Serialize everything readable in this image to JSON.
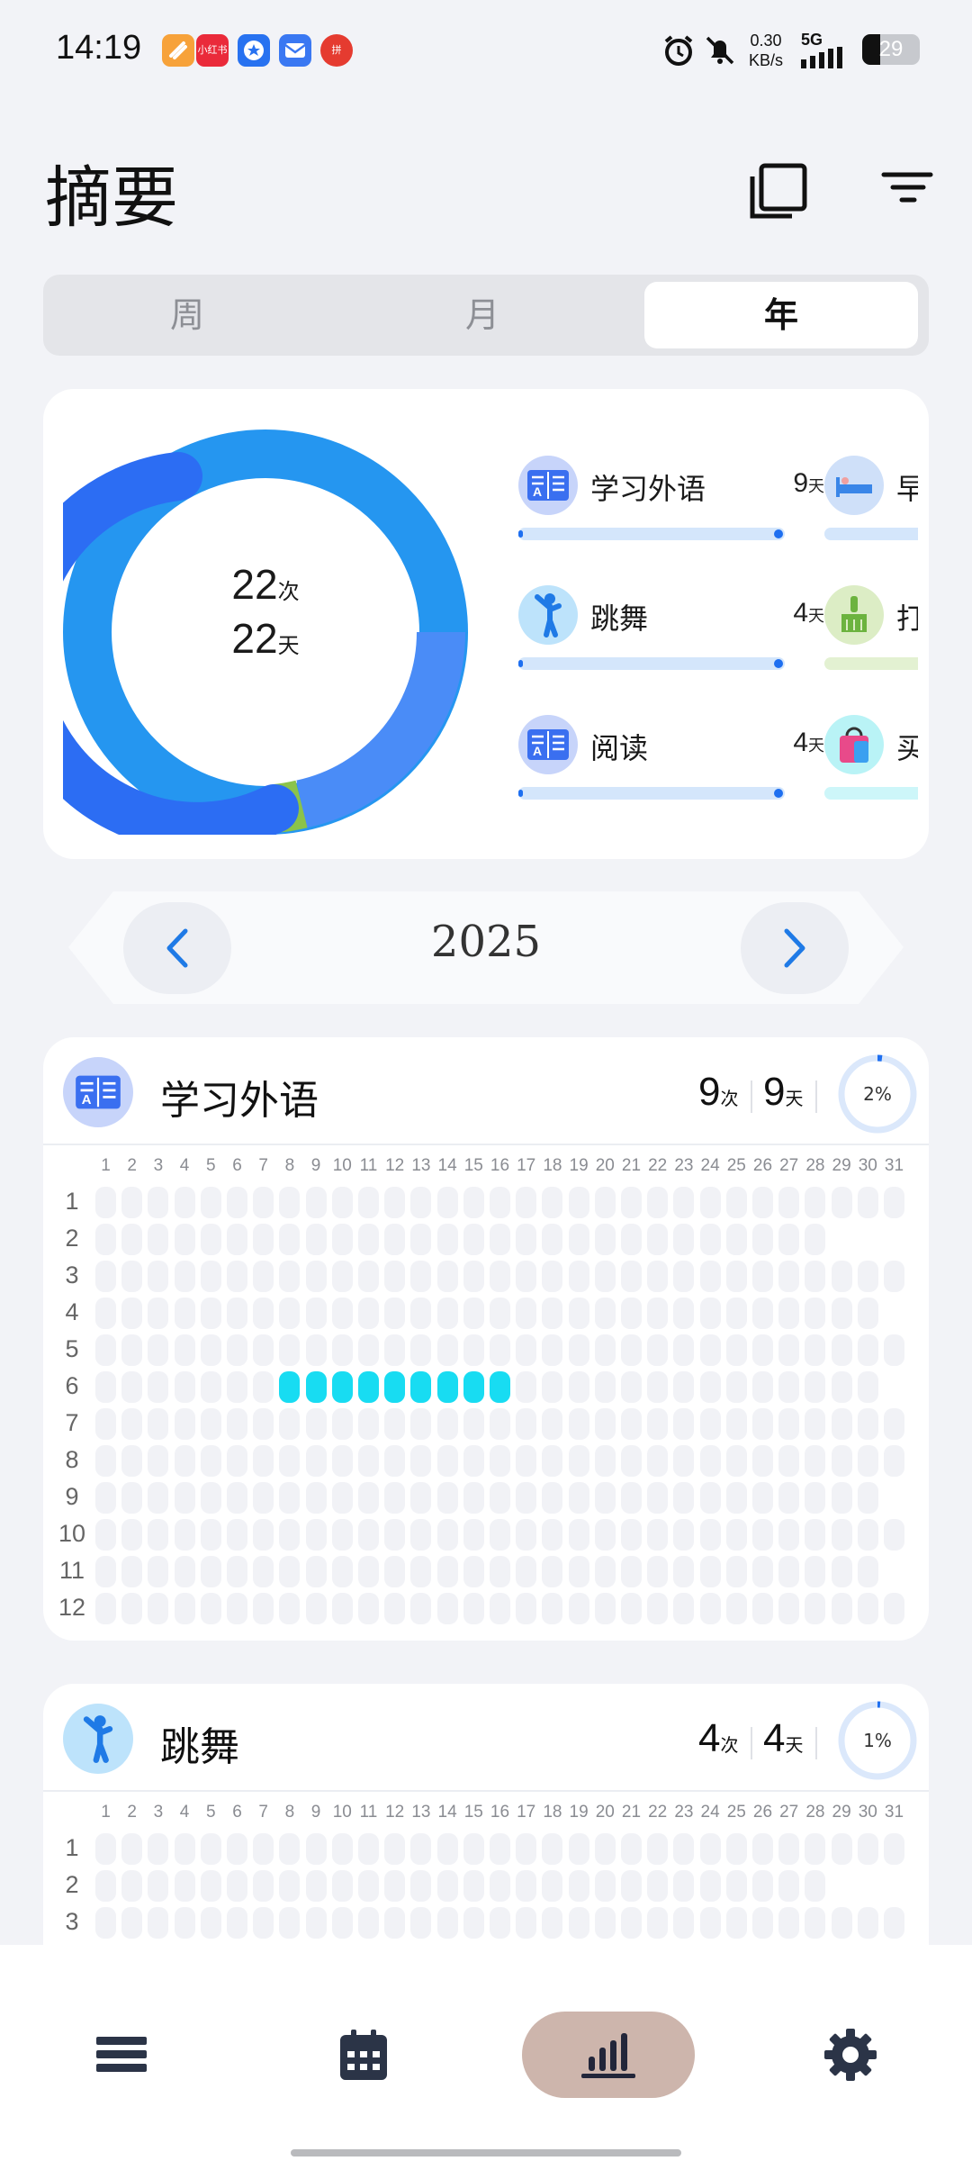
{
  "status": {
    "time": "14:19",
    "net_speed_value": "0.30",
    "net_speed_unit": "KB/s",
    "net_type": "5G",
    "battery": "29",
    "notification_app_labels": [
      "",
      "小红书",
      "",
      "",
      "拼"
    ]
  },
  "header": {
    "title": "摘要"
  },
  "tabs": {
    "week": "周",
    "month": "月",
    "year": "年",
    "selected": "年"
  },
  "summary": {
    "count": "22",
    "count_unit": "次",
    "days": "22",
    "days_unit": "天",
    "habits": [
      {
        "name": "学习外语",
        "days": "9",
        "unit": "天",
        "icon": "book-icon"
      },
      {
        "name": "跳舞",
        "days": "4",
        "unit": "天",
        "icon": "dance-icon"
      },
      {
        "name": "阅读",
        "days": "4",
        "unit": "天",
        "icon": "book-icon"
      }
    ],
    "habits_partial": [
      {
        "name": "早",
        "icon": "bed-icon"
      },
      {
        "name": "打",
        "icon": "broom-icon"
      },
      {
        "name": "买",
        "icon": "shopping-bag-icon"
      }
    ]
  },
  "year_nav": {
    "year": "2025"
  },
  "habit_cards": [
    {
      "title": "学习外语",
      "count": "9",
      "count_unit": "次",
      "days": "9",
      "days_unit": "天",
      "percent": "2%",
      "percent_value": 0.02,
      "icon": "book-icon"
    },
    {
      "title": "跳舞",
      "count": "4",
      "count_unit": "次",
      "days": "4",
      "days_unit": "天",
      "percent": "1%",
      "percent_value": 0.01,
      "icon": "dance-icon"
    }
  ],
  "grid": {
    "days": [
      "1",
      "2",
      "3",
      "4",
      "5",
      "6",
      "7",
      "8",
      "9",
      "10",
      "11",
      "12",
      "13",
      "14",
      "15",
      "16",
      "17",
      "18",
      "19",
      "20",
      "21",
      "22",
      "23",
      "24",
      "25",
      "26",
      "27",
      "28",
      "29",
      "30",
      "31"
    ],
    "months": [
      "1",
      "2",
      "3",
      "4",
      "5",
      "6",
      "7",
      "8",
      "9",
      "10",
      "11",
      "12"
    ],
    "days_in_month": [
      31,
      28,
      31,
      30,
      31,
      30,
      31,
      31,
      30,
      31,
      30,
      31
    ],
    "card1_marked": {
      "month": 6,
      "days": [
        8,
        9,
        10,
        11,
        12,
        13,
        14,
        15,
        16
      ]
    }
  },
  "colors": {
    "accent_blue": "#2c6df3",
    "donut_light_blue": "#2596f0",
    "donut_mid_blue": "#4a8cf7",
    "donut_green": "#8bc34a",
    "marked_cell": "#18dcf2",
    "nav_active_bg": "#cdb5ac"
  },
  "bottom_nav": {
    "items": [
      "list-icon",
      "calendar-icon",
      "chart-icon",
      "gear-icon"
    ],
    "active": "chart-icon"
  }
}
